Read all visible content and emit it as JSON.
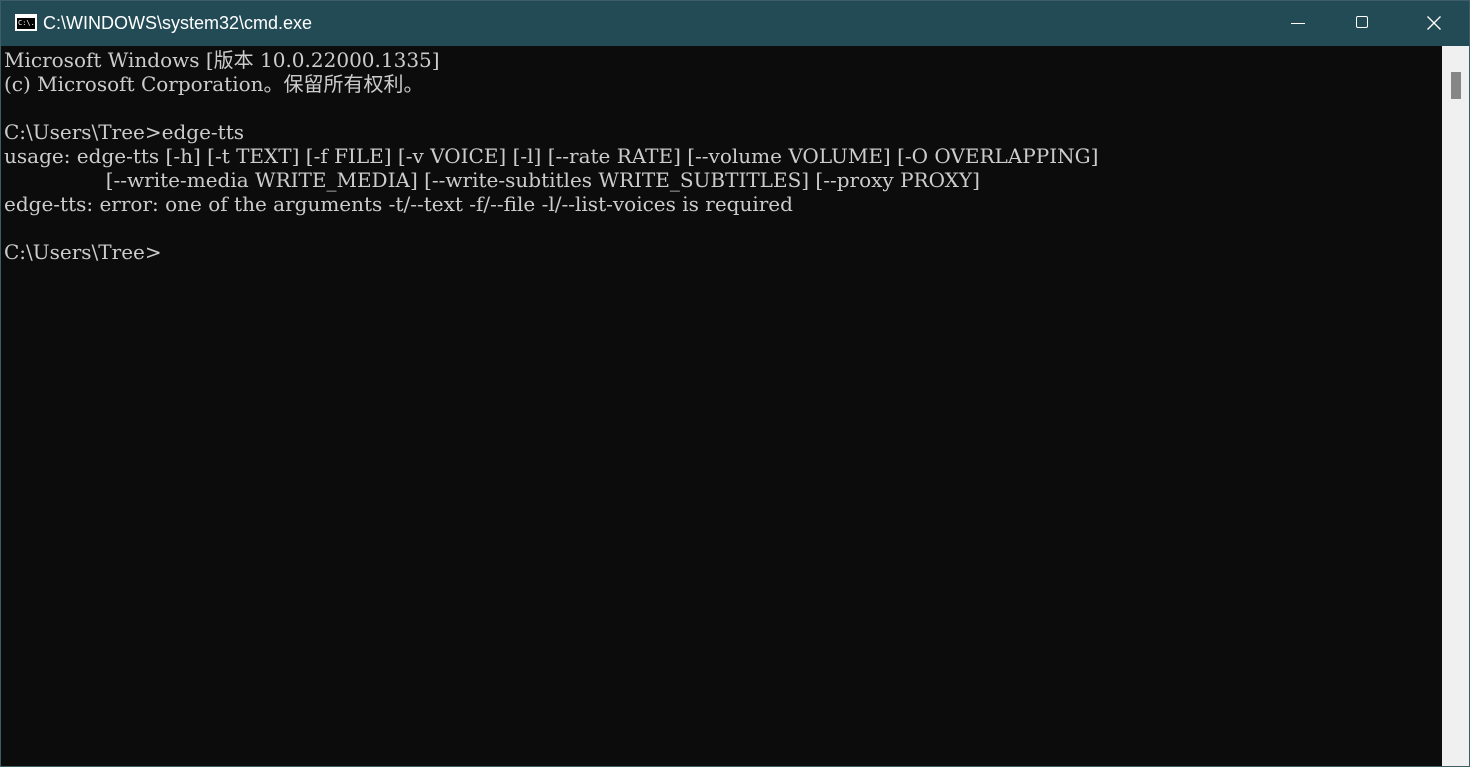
{
  "window": {
    "title": "C:\\WINDOWS\\system32\\cmd.exe",
    "icon_text": "C:\\."
  },
  "console": {
    "lines": [
      "Microsoft Windows [版本 10.0.22000.1335]",
      "(c) Microsoft Corporation。保留所有权利。",
      "",
      "C:\\Users\\Tree>edge-tts",
      "usage: edge-tts [-h] [-t TEXT] [-f FILE] [-v VOICE] [-l] [--rate RATE] [--volume VOLUME] [-O OVERLAPPING]",
      "                [--write-media WRITE_MEDIA] [--write-subtitles WRITE_SUBTITLES] [--proxy PROXY]",
      "edge-tts: error: one of the arguments -t/--text -f/--file -l/--list-voices is required",
      "",
      "C:\\Users\\Tree>"
    ]
  },
  "colors": {
    "titlebar": "#234b56",
    "console_bg": "#0c0c0c",
    "console_text": "#cccccc",
    "scrollbar_track": "#f0f0f0",
    "scrollbar_thumb": "#868686"
  },
  "icons": {
    "app": "cmd-icon",
    "minimize": "minimize-icon",
    "maximize": "maximize-icon",
    "close": "close-icon"
  }
}
